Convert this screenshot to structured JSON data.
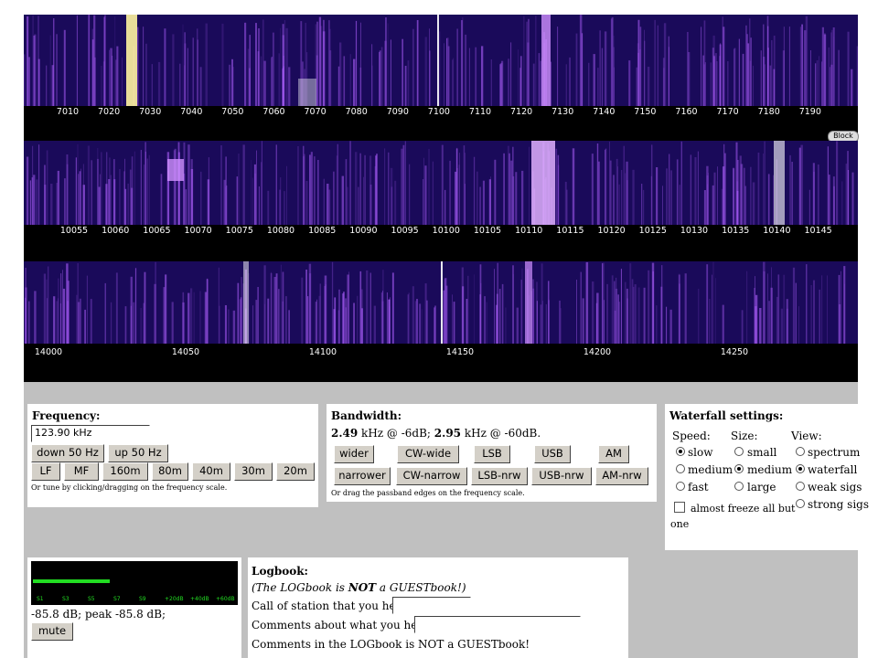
{
  "waterfall": {
    "band1_ticks": [
      "7010",
      "7020",
      "7030",
      "7040",
      "7050",
      "7060",
      "7070",
      "7080",
      "7090",
      "7100",
      "7110",
      "7120",
      "7130",
      "7140",
      "7150",
      "7160",
      "7170",
      "7180",
      "7190"
    ],
    "band2_ticks": [
      "10055",
      "10060",
      "10065",
      "10070",
      "10075",
      "10080",
      "10085",
      "10090",
      "10095",
      "10100",
      "10105",
      "10110",
      "10115",
      "10120",
      "10125",
      "10130",
      "10135",
      "10140",
      "10145"
    ],
    "band3_ticks": [
      "14000",
      "14050",
      "14100",
      "14150",
      "14200",
      "14250"
    ],
    "block_label": "Block",
    "colors": {
      "background": "#1a0a5a",
      "signal": "#b060ff",
      "strong": "#fff4a0"
    }
  },
  "frequency": {
    "title": "Frequency:",
    "value": "123.90 kHz",
    "down_label": "down 50 Hz",
    "up_label": "up 50 Hz",
    "bands": [
      "LF",
      "MF",
      "160m",
      "80m",
      "40m",
      "30m",
      "20m"
    ],
    "hint": "Or tune by clicking/dragging on the frequency scale."
  },
  "bandwidth": {
    "title": "Bandwidth:",
    "line_value1": "2.49",
    "line_text1": " kHz @ -6dB; ",
    "line_value2": "2.95",
    "line_text2": " kHz @ -60dB.",
    "row1": [
      "wider",
      "CW-wide",
      "LSB",
      "USB",
      "AM"
    ],
    "row2": [
      "narrower",
      "CW-narrow",
      "LSB-nrw",
      "USB-nrw",
      "AM-nrw"
    ],
    "hint": "Or drag the passband edges on the frequency scale."
  },
  "waterfall_settings": {
    "title": "Waterfall settings:",
    "speed_label": "Speed:",
    "size_label": "Size:",
    "view_label": "View:",
    "speed_options": [
      "slow",
      "medium",
      "fast"
    ],
    "size_options": [
      "small",
      "medium",
      "large"
    ],
    "view_options": [
      "spectrum",
      "waterfall",
      "weak sigs",
      "strong sigs"
    ],
    "speed_selected": "slow",
    "size_selected": "medium",
    "view_selected": "waterfall",
    "freeze_label_1": "almost freeze all but",
    "freeze_label_2": "one"
  },
  "smeter": {
    "scale_labels": [
      "S1",
      "S3",
      "S5",
      "S7",
      "S9",
      "+20dB",
      "+40dB",
      "+60dB"
    ],
    "level_fraction": 0.38,
    "readout": "-85.8 dB; peak -85.8 dB;",
    "mute_label": "mute",
    "bar_color": "#22dd22"
  },
  "logbook": {
    "title": "Logbook:",
    "note_prefix": "(The LOGbook is ",
    "note_bold": "NOT",
    "note_middle": " a ",
    "note_guest": "GUESTbook!",
    "note_suffix": ")",
    "call_label": "Call of station that you hear:",
    "comments_label": "Comments about what you hear:",
    "cut_line": "Comments in the LOGbook is NOT a GUESTbook!"
  }
}
